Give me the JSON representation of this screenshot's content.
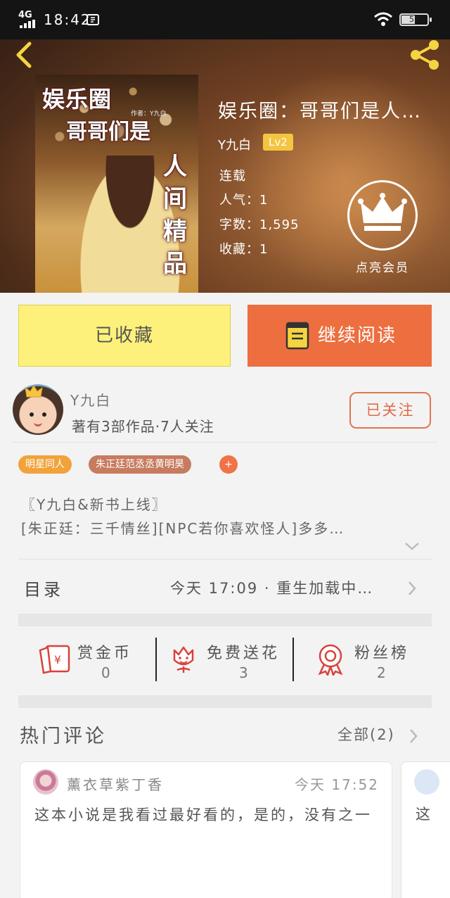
{
  "status_bar": {
    "network": "4G",
    "time": "18:42",
    "battery": "52",
    "battery_level": 0.52
  },
  "cover": {
    "line1": "娱乐圈",
    "line2": "哥哥们是",
    "small_text": "作者：Y九白",
    "vertical_chars": [
      "人",
      "间",
      "精",
      "品"
    ]
  },
  "book": {
    "title": "娱乐圈：哥哥们是人…",
    "author": "Y九白",
    "level": "Lv2",
    "status": "连载",
    "popularity": "人气：1",
    "word_count": "字数：1,595",
    "favorites": "收藏：1"
  },
  "vip": {
    "label": "点亮会员"
  },
  "actions": {
    "collected_label": "已收藏",
    "read_label": "继续阅读"
  },
  "writer": {
    "name": "Y九白",
    "stats": "著有3部作品·7人关注",
    "follow_label": "已关注"
  },
  "tags": [
    {
      "label": "明星同人",
      "color": "#f2a23a"
    },
    {
      "label": "朱正廷范丞丞黄明昊",
      "color": "#c77b5f"
    }
  ],
  "tag_add": "+",
  "description": {
    "line1": "〖Y九白&新书上线〗",
    "line2": "[朱正廷：三千情丝][NPC若你喜欢怪人]多多…"
  },
  "toc": {
    "label": "目录",
    "latest": "今天 17:09 · 重生加载中…"
  },
  "stats": {
    "reward": {
      "label": "赏金币",
      "value": "0"
    },
    "flower": {
      "label": "免费送花",
      "value": "3"
    },
    "fans": {
      "label": "粉丝榜",
      "value": "2"
    }
  },
  "comments": {
    "title": "热门评论",
    "all_label": "全部(2)",
    "items": [
      {
        "user": "薰衣草紫丁香",
        "time": "今天 17:52",
        "text": "这本小说是我看过最好看的，是的，没有之一"
      },
      {
        "text": "这"
      }
    ]
  },
  "colors": {
    "accent_orange": "#ed6e3f",
    "collected_yellow": "#fdf17b",
    "badge_yellow": "#f5c542"
  }
}
